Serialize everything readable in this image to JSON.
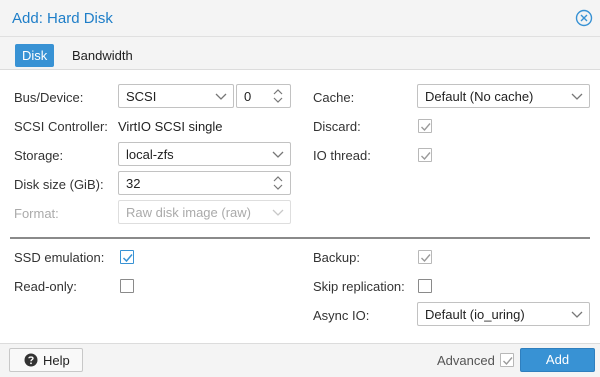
{
  "dialog": {
    "title": "Add: Hard Disk"
  },
  "tabs": [
    {
      "label": "Disk",
      "active": true
    },
    {
      "label": "Bandwidth",
      "active": false
    }
  ],
  "left": {
    "bus_device": {
      "label": "Bus/Device:",
      "bus_value": "SCSI",
      "device_value": "0"
    },
    "scsi_controller": {
      "label": "SCSI Controller:",
      "value": "VirtIO SCSI single"
    },
    "storage": {
      "label": "Storage:",
      "value": "local-zfs"
    },
    "disk_size": {
      "label": "Disk size (GiB):",
      "value": "32"
    },
    "format": {
      "label": "Format:",
      "value": "Raw disk image (raw)",
      "disabled": true
    }
  },
  "right": {
    "cache": {
      "label": "Cache:",
      "value": "Default (No cache)"
    },
    "discard": {
      "label": "Discard:",
      "checked": true,
      "disabled": true
    },
    "io_thread": {
      "label": "IO thread:",
      "checked": true,
      "disabled": true
    }
  },
  "advanced": {
    "ssd_emulation": {
      "label": "SSD emulation:",
      "checked": true
    },
    "read_only": {
      "label": "Read-only:",
      "checked": false
    },
    "backup": {
      "label": "Backup:",
      "checked": true,
      "disabled": true
    },
    "skip_replication": {
      "label": "Skip replication:",
      "checked": false
    },
    "async_io": {
      "label": "Async IO:",
      "value": "Default (io_uring)"
    }
  },
  "footer": {
    "help_label": "Help",
    "advanced_label": "Advanced",
    "advanced_checked": true,
    "add_label": "Add"
  },
  "colors": {
    "accent": "#3892d4",
    "title": "#1e7ec8"
  },
  "icons": {
    "close": "close-circle-icon",
    "help": "question-circle-icon",
    "dropdown": "chevron-down-icon",
    "spinner": "spinner-updown-icon"
  }
}
